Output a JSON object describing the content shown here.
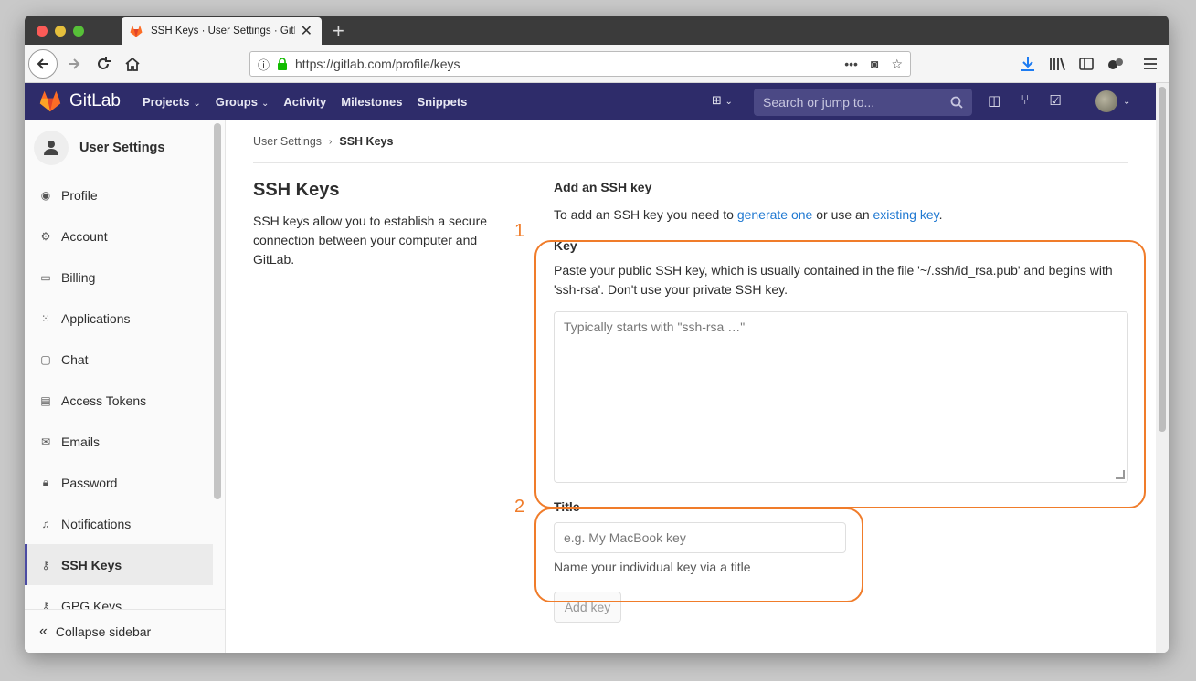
{
  "browser": {
    "tab_title": "SSH Keys · User Settings · GitLab",
    "url": "https://gitlab.com/profile/keys"
  },
  "gitlab": {
    "brand": "GitLab",
    "menu": [
      {
        "label": "Projects",
        "has_caret": true
      },
      {
        "label": "Groups",
        "has_caret": true
      },
      {
        "label": "Activity",
        "has_caret": false
      },
      {
        "label": "Milestones",
        "has_caret": false
      },
      {
        "label": "Snippets",
        "has_caret": false
      }
    ],
    "search_placeholder": "Search or jump to..."
  },
  "sidebar": {
    "title": "User Settings",
    "items": [
      {
        "label": "Profile",
        "icon": "profile-icon"
      },
      {
        "label": "Account",
        "icon": "account-icon"
      },
      {
        "label": "Billing",
        "icon": "billing-icon"
      },
      {
        "label": "Applications",
        "icon": "applications-icon"
      },
      {
        "label": "Chat",
        "icon": "chat-icon"
      },
      {
        "label": "Access Tokens",
        "icon": "token-icon"
      },
      {
        "label": "Emails",
        "icon": "email-icon"
      },
      {
        "label": "Password",
        "icon": "lock-icon"
      },
      {
        "label": "Notifications",
        "icon": "bell-icon"
      },
      {
        "label": "SSH Keys",
        "icon": "key-icon",
        "active": true
      },
      {
        "label": "GPG Keys",
        "icon": "key-icon"
      }
    ],
    "collapse_label": "Collapse sidebar"
  },
  "breadcrumb": {
    "parent": "User Settings",
    "current": "SSH Keys"
  },
  "intro": {
    "heading": "SSH Keys",
    "description": "SSH keys allow you to establish a secure connection between your computer and GitLab."
  },
  "form": {
    "heading": "Add an SSH key",
    "intro_prefix": "To add an SSH key you need to ",
    "intro_link1": "generate one",
    "intro_middle": " or use an ",
    "intro_link2": "existing key",
    "intro_suffix": ".",
    "key_label": "Key",
    "key_help": "Paste your public SSH key, which is usually contained in the file '~/.ssh/id_rsa.pub' and begins with 'ssh-rsa'. Don't use your private SSH key.",
    "key_placeholder": "Typically starts with \"ssh-rsa …\"",
    "title_label": "Title",
    "title_placeholder": "e.g. My MacBook key",
    "title_help": "Name your individual key via a title",
    "add_button": "Add key"
  },
  "annotations": {
    "one": "1",
    "two": "2",
    "color": "#f07c2a"
  }
}
